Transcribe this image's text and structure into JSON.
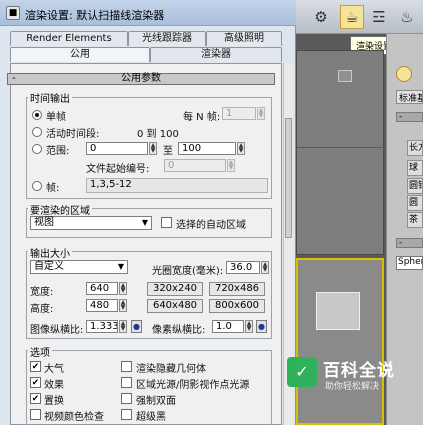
{
  "dialog": {
    "title": "渲染设置: 默认扫描线渲染器",
    "tabs_row1": [
      "Render Elements",
      "光线跟踪器",
      "高级照明"
    ],
    "tabs_row2": [
      "公用",
      "渲染器"
    ],
    "rollout_title": "公用参数",
    "rollout_toggle": "-"
  },
  "time_output": {
    "label": "时间输出",
    "single": "单帧",
    "every_n_label": "每 N 帧:",
    "every_n_value": "1",
    "active_segment": "活动时间段:",
    "active_range": "0 到 100",
    "range_label": "范围:",
    "range_from": "0",
    "range_to_label": "至",
    "range_to": "100",
    "file_start_label": "文件起始编号:",
    "file_start_value": "0",
    "frames_label": "帧:",
    "frames_value": "1,3,5-12",
    "selected": "单帧"
  },
  "render_area": {
    "label": "要渲染的区域",
    "selected": "视图",
    "auto_region": "选择的自动区域",
    "auto_region_checked": false
  },
  "output_size": {
    "label": "输出大小",
    "preset": "自定义",
    "aperture_label": "光圈宽度(毫米):",
    "aperture_value": "36.0",
    "width_label": "宽度:",
    "width_value": "640",
    "height_label": "高度:",
    "height_value": "480",
    "presets": [
      "320x240",
      "720x486",
      "640x480",
      "800x600"
    ],
    "image_aspect_label": "图像纵横比:",
    "image_aspect_value": "1.333",
    "pixel_aspect_label": "像素纵横比:",
    "pixel_aspect_value": "1.0"
  },
  "options": {
    "label": "选项",
    "items": [
      {
        "label": "大气",
        "checked": true
      },
      {
        "label": "渲染隐藏几何体",
        "checked": false
      },
      {
        "label": "效果",
        "checked": true
      },
      {
        "label": "区域光源/阴影视作点光源",
        "checked": false
      },
      {
        "label": "置换",
        "checked": true
      },
      {
        "label": "强制双面",
        "checked": false
      },
      {
        "label": "视频颜色检查",
        "checked": false
      },
      {
        "label": "超级黑",
        "checked": false
      }
    ]
  },
  "background_app": {
    "tooltip": "渲染设置",
    "command_panel_label": "标准基",
    "command_buttons": [
      "长方",
      "球",
      "圆锥",
      "圆",
      "茶"
    ],
    "command_field": "Spher",
    "toolbar_icons": [
      "teapot-render-icon",
      "render-setup-icon",
      "render-frame-icon",
      "render-icon"
    ]
  },
  "watermark": {
    "title": "百科全说",
    "subtitle": "助你轻松解决"
  }
}
